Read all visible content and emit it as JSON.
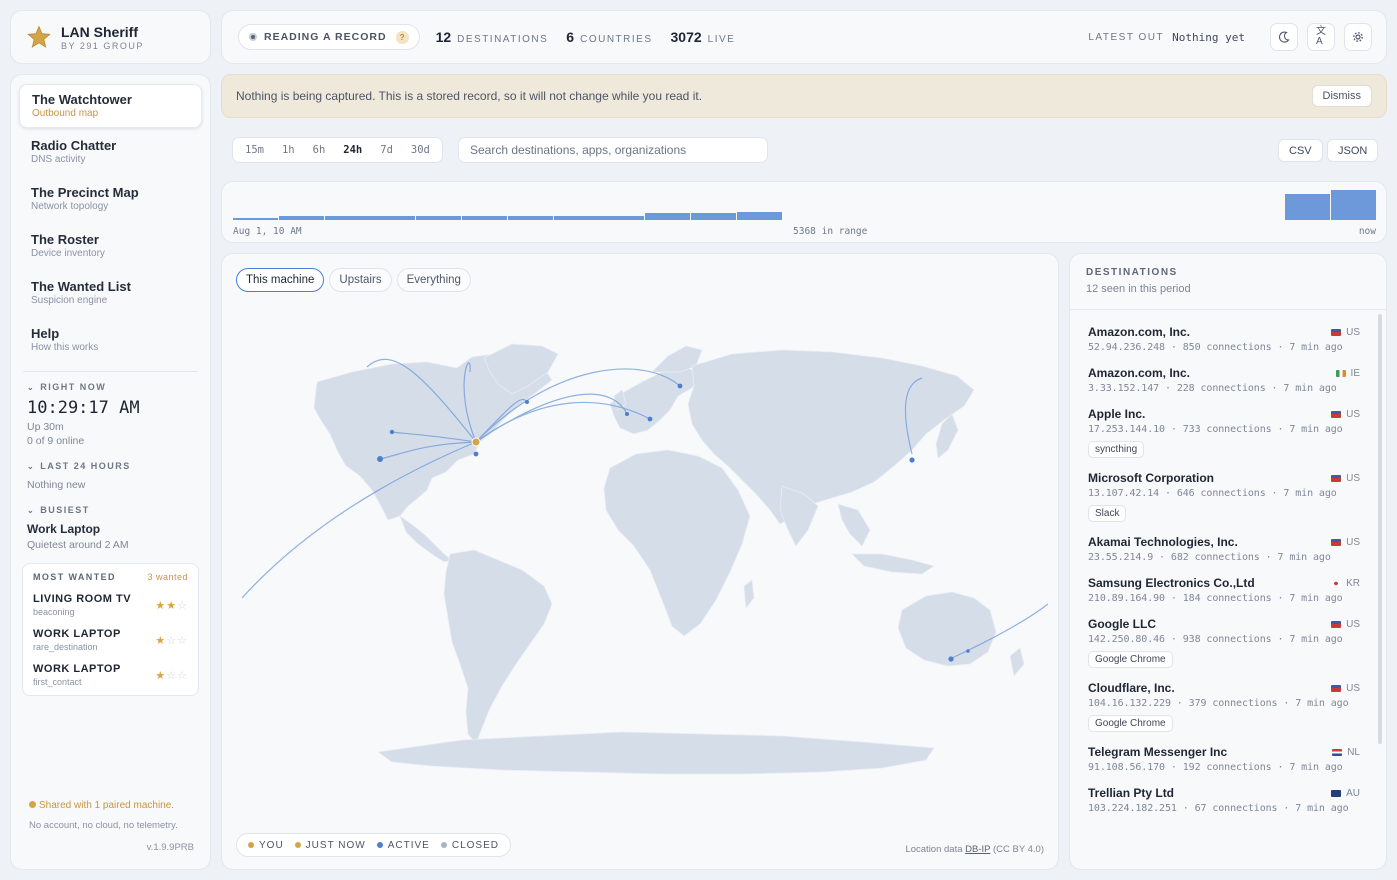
{
  "brand": {
    "name": "LAN Sheriff",
    "sub": "BY 291 GROUP"
  },
  "nav": [
    {
      "title": "The Watchtower",
      "sub": "Outbound map",
      "active": true
    },
    {
      "title": "Radio Chatter",
      "sub": "DNS activity"
    },
    {
      "title": "The Precinct Map",
      "sub": "Network topology"
    },
    {
      "title": "The Roster",
      "sub": "Device inventory"
    },
    {
      "title": "The Wanted List",
      "sub": "Suspicion engine"
    },
    {
      "title": "Help",
      "sub": "How this works"
    }
  ],
  "status": {
    "right_now_label": "RIGHT NOW",
    "clock": "10:29:17 AM",
    "uptime": "Up 30m",
    "online": "0 of 9 online",
    "last24_label": "LAST 24 HOURS",
    "last24_value": "Nothing new",
    "busiest_label": "BUSIEST",
    "busiest_name": "Work Laptop",
    "busiest_sub": "Quietest around 2 AM"
  },
  "most_wanted": {
    "title": "MOST WANTED",
    "count": "3 wanted",
    "items": [
      {
        "name": "LIVING ROOM TV",
        "reason": "beaconing",
        "stars": 2
      },
      {
        "name": "WORK LAPTOP",
        "reason": "rare_destination",
        "stars": 1
      },
      {
        "name": "WORK LAPTOP",
        "reason": "first_contact",
        "stars": 1
      }
    ]
  },
  "footer": {
    "shared": "Shared with 1 paired machine.",
    "noaccount": "No account, no cloud, no telemetry.",
    "version": "v.1.9.9PRB"
  },
  "topbar": {
    "reading": "READING A RECORD",
    "help": "?",
    "destinations_value": "12",
    "destinations_label": "DESTINATIONS",
    "countries_value": "6",
    "countries_label": "COUNTRIES",
    "live_value": "3072",
    "live_label": "LIVE",
    "latest_label": "LATEST OUT",
    "latest_value": "Nothing yet",
    "theme_icon": "moon-icon",
    "lang_icon": "translate-icon",
    "settings_icon": "gear-icon"
  },
  "banner": {
    "text": "Nothing is being captured. This is a stored record, so it will not change while you read it.",
    "dismiss": "Dismiss"
  },
  "filters": {
    "ranges": [
      "15m",
      "1h",
      "6h",
      "24h",
      "7d",
      "30d"
    ],
    "selected": "24h",
    "search_placeholder": "Search destinations, apps, organizations",
    "csv": "CSV",
    "json": "JSON"
  },
  "timeline": {
    "start_label": "Aug 1, 10 AM",
    "range_label": "5368 in range",
    "end_label": "now",
    "bars": [
      0.15,
      0.45,
      0.45,
      0.45,
      0.45,
      0.45,
      0.45,
      0.45,
      0.45,
      0.7,
      0.7,
      0.85
    ],
    "live_bars": [
      2.6,
      3.0
    ]
  },
  "map": {
    "scopes": [
      "This machine",
      "Upstairs",
      "Everything"
    ],
    "selected_scope": "This machine",
    "legend": [
      {
        "label": "YOU",
        "color": "#d4a548"
      },
      {
        "label": "JUST NOW",
        "color": "#d4a548"
      },
      {
        "label": "ACTIVE",
        "color": "#4d7fcf"
      },
      {
        "label": "CLOSED",
        "color": "#a9b3c4"
      }
    ],
    "attribution_prefix": "Location data",
    "attribution_link": "DB-IP",
    "attribution_suffix": "(CC BY 4.0)"
  },
  "destinations": {
    "title": "DESTINATIONS",
    "subtitle": "12 seen in this period",
    "items": [
      {
        "org": "Amazon.com, Inc.",
        "cc": "US",
        "ip": "52.94.236.248",
        "conn": "850 connections",
        "ago": "7 min ago",
        "chip": ""
      },
      {
        "org": "Amazon.com, Inc.",
        "cc": "IE",
        "ip": "3.33.152.147",
        "conn": "228 connections",
        "ago": "7 min ago",
        "chip": ""
      },
      {
        "org": "Apple Inc.",
        "cc": "US",
        "ip": "17.253.144.10",
        "conn": "733 connections",
        "ago": "7 min ago",
        "chip": "syncthing"
      },
      {
        "org": "Microsoft Corporation",
        "cc": "US",
        "ip": "13.107.42.14",
        "conn": "646 connections",
        "ago": "7 min ago",
        "chip": "Slack"
      },
      {
        "org": "Akamai Technologies, Inc.",
        "cc": "US",
        "ip": "23.55.214.9",
        "conn": "682 connections",
        "ago": "7 min ago",
        "chip": ""
      },
      {
        "org": "Samsung Electronics Co.,Ltd",
        "cc": "KR",
        "ip": "210.89.164.90",
        "conn": "184 connections",
        "ago": "7 min ago",
        "chip": ""
      },
      {
        "org": "Google LLC",
        "cc": "US",
        "ip": "142.250.80.46",
        "conn": "938 connections",
        "ago": "7 min ago",
        "chip": "Google Chrome"
      },
      {
        "org": "Cloudflare, Inc.",
        "cc": "US",
        "ip": "104.16.132.229",
        "conn": "379 connections",
        "ago": "7 min ago",
        "chip": "Google Chrome"
      },
      {
        "org": "Telegram Messenger Inc",
        "cc": "NL",
        "ip": "91.108.56.170",
        "conn": "192 connections",
        "ago": "7 min ago",
        "chip": ""
      },
      {
        "org": "Trellian Pty Ltd",
        "cc": "AU",
        "ip": "103.224.182.251",
        "conn": "67 connections",
        "ago": "7 min ago",
        "chip": ""
      }
    ]
  },
  "colors": {
    "accent_gold": "#d4a548",
    "accent_blue": "#4d7fcf",
    "land": "#d5dde9"
  }
}
